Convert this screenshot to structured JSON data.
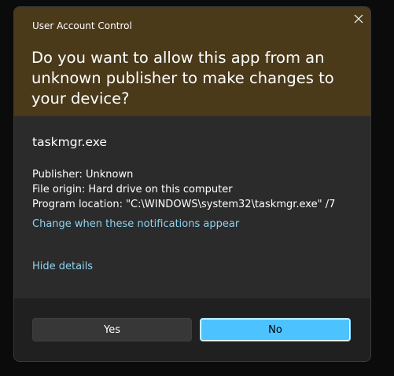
{
  "dialog": {
    "title": "User Account Control",
    "question": "Do you want to allow this app from an unknown publisher to make changes to your device?",
    "app_name": "taskmgr.exe",
    "publisher": "Publisher: Unknown",
    "file_origin": "File origin: Hard drive on this computer",
    "program_location": "Program location: \"C:\\WINDOWS\\system32\\taskmgr.exe\" /7",
    "change_link": "Change when these notifications appear",
    "hide_details_link": "Hide details",
    "yes_label": "Yes",
    "no_label": "No",
    "close_icon": "close-icon"
  },
  "colors": {
    "header_bg": "#4a3a1a",
    "accent": "#4cc2ff",
    "link": "#8fd2f0"
  }
}
